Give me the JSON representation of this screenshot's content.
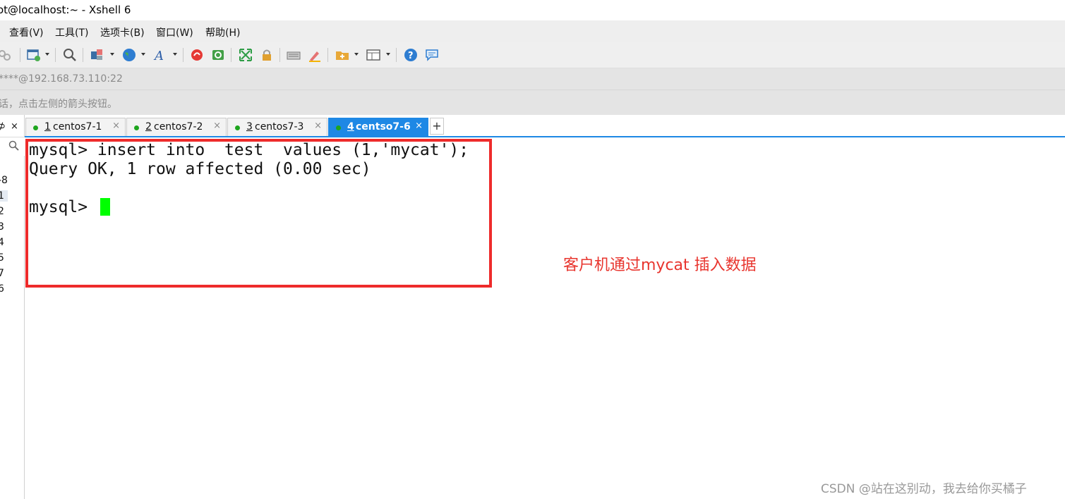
{
  "window": {
    "title": "ot@localhost:~ - Xshell 6"
  },
  "menu": [
    "查看(V)",
    "工具(T)",
    "选项卡(B)",
    "窗口(W)",
    "帮助(H)"
  ],
  "toolbar_icons": [
    "link-icon",
    "new-session-icon",
    "search-icon",
    "properties-icon",
    "globe-icon",
    "font-icon",
    "xftp-icon",
    "xmanager-icon",
    "fullscreen-icon",
    "lock-icon",
    "keyboard-icon",
    "highlighter-icon",
    "new-folder-icon",
    "layout-icon",
    "help-icon",
    "chat-icon"
  ],
  "address": "****@192.168.73.110:22",
  "hint": "话，点击左侧的箭头按钮。",
  "panel": {
    "pin": "⊅",
    "close": "×",
    "sessions": [
      "-8",
      "1",
      "2",
      "3",
      "4",
      "5",
      "7",
      "6"
    ]
  },
  "tabs": [
    {
      "num": "1",
      "label": " centos7-1",
      "status_color": "#1ea51e"
    },
    {
      "num": "2",
      "label": " centos7-2",
      "status_color": "#1ea51e"
    },
    {
      "num": "3",
      "label": " centos7-3",
      "status_color": "#1ea51e"
    },
    {
      "num": "4",
      "label": " centso7-6",
      "status_color": "#1ea51e",
      "active": true
    }
  ],
  "tab_close": "×",
  "tab_add": "+",
  "terminal": {
    "lines": [
      "mysql> insert into  test  values (1,'mycat');",
      "Query OK, 1 row affected (0.00 sec)",
      "",
      "mysql> "
    ]
  },
  "annotation": "客户机通过mycat  插入数据",
  "watermark": "CSDN @站在这别动，我去给你买橘子",
  "colors": {
    "accent": "#1e88e5",
    "highlight": "#ee2b2b",
    "cursor": "#00ff00"
  }
}
